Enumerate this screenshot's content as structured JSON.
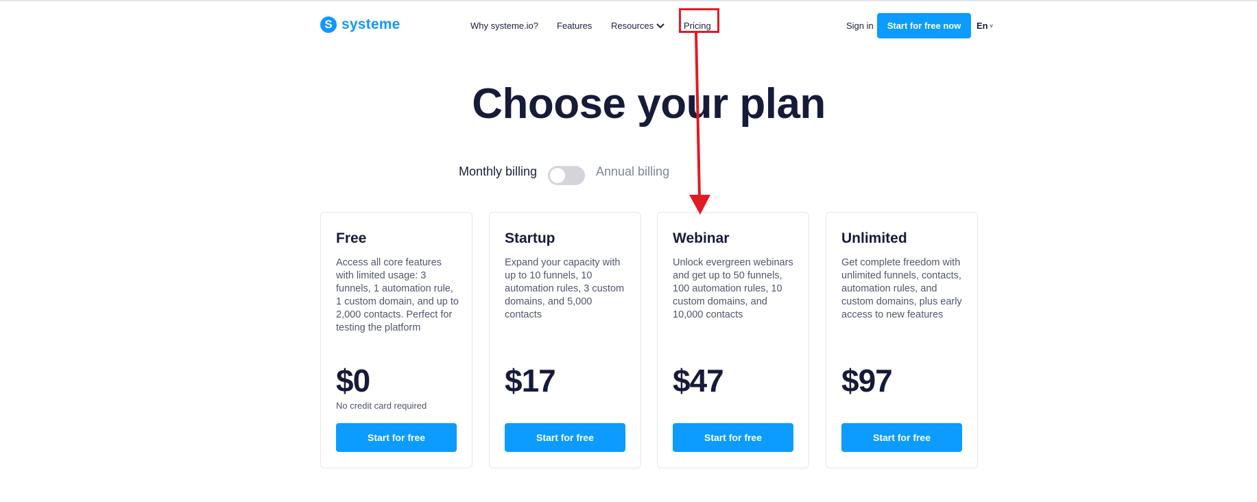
{
  "header": {
    "logo_letter": "S",
    "logo_text": "systeme",
    "nav": {
      "why": "Why systeme.io?",
      "features": "Features",
      "resources": "Resources",
      "pricing": "Pricing"
    },
    "sign_in": "Sign in",
    "cta": "Start for free now",
    "language": "En",
    "brand_color": "#0c9bff"
  },
  "main": {
    "title": "Choose your plan",
    "billing": {
      "monthly_label": "Monthly billing",
      "annual_label": "Annual billing",
      "annual_selected": false
    },
    "plans": [
      {
        "name": "Free",
        "description": "Access all core features with limited usage: 3 funnels, 1 automation rule, 1 custom domain, and up to 2,000 contacts. Perfect for testing the platform",
        "price": "$0",
        "note": "No credit card required",
        "button": "Start for free"
      },
      {
        "name": "Startup",
        "description": "Expand your capacity with up to 10 funnels, 10 automation rules, 3 custom domains, and 5,000 contacts",
        "price": "$17",
        "note": "",
        "button": "Start for free"
      },
      {
        "name": "Webinar",
        "description": "Unlock evergreen webinars and get up to 50 funnels, 100 automation rules, 10 custom domains, and 10,000 contacts",
        "price": "$47",
        "note": "",
        "button": "Start for free"
      },
      {
        "name": "Unlimited",
        "description": "Get complete freedom with unlimited funnels, contacts, automation rules, and custom domains, plus early access to new features",
        "price": "$97",
        "note": "",
        "button": "Start for free"
      }
    ]
  },
  "annotation": {
    "highlight_color": "#e01b24"
  }
}
